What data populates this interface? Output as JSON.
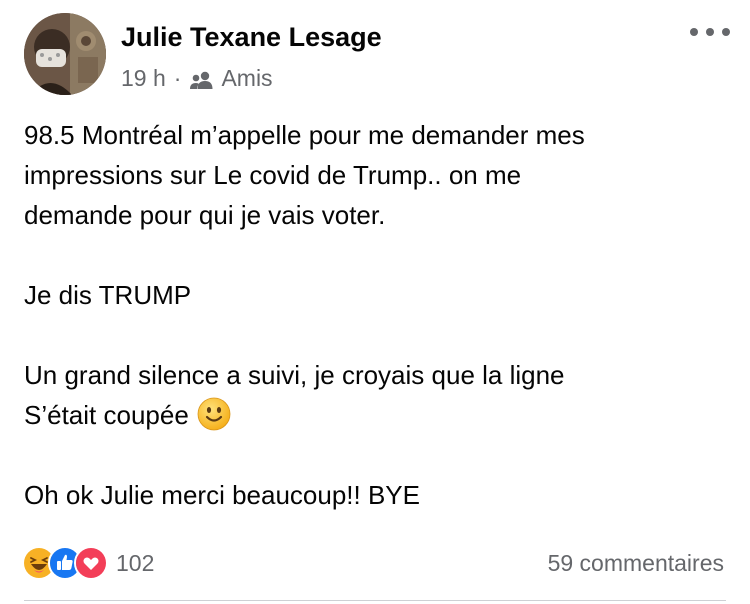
{
  "post": {
    "author": "Julie Texane Lesage",
    "time": "19 h",
    "separator": "·",
    "audience": "Amis",
    "audience_icon": "friends-icon",
    "more_icon": "more-horizontal-icon",
    "text": {
      "p1_line1": "98.5 Montréal m’appelle pour me demander mes",
      "p1_line2": "impressions sur Le covid de Trump.. on me",
      "p1_line3": "demande pour qui je vais voter.",
      "p2": "Je dis TRUMP",
      "p3_line1": "Un grand silence a suivi, je croyais que la ligne",
      "p3_line2": "S’était coupée",
      "p3_emoji": "slightly-smiling-face-emoji",
      "p4": "Oh ok Julie merci beaucoup!! BYE"
    }
  },
  "footer": {
    "reactions": [
      "haha",
      "like",
      "love"
    ],
    "reaction_count": "102",
    "comments": "59 commentaires"
  },
  "colors": {
    "text": "#050505",
    "secondary_text": "#65676b",
    "like_blue": "#1877f2",
    "love_red": "#f33e58",
    "haha_yellow": "#f7b125"
  }
}
